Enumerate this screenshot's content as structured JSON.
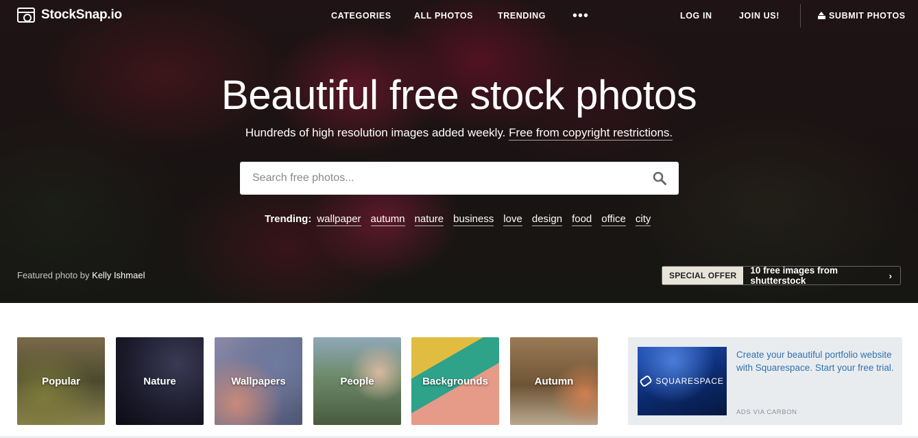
{
  "nav": {
    "brand": "StockSnap.io",
    "categories": "CATEGORIES",
    "all_photos": "ALL PHOTOS",
    "trending": "TRENDING",
    "more": "•••",
    "log_in": "LOG IN",
    "join": "JOIN US!",
    "submit": "SUBMIT PHOTOS"
  },
  "hero": {
    "headline": "Beautiful free stock photos",
    "subline": "Hundreds of high resolution images added weekly.",
    "subline_link": "Free from copyright restrictions.",
    "search_placeholder": "Search free photos...",
    "trending_label": "Trending:",
    "trending_tags": [
      "wallpaper",
      "autumn",
      "nature",
      "business",
      "love",
      "design",
      "food",
      "office",
      "city"
    ],
    "featured_prefix": "Featured photo by",
    "featured_author": "Kelly Ishmael",
    "offer_badge": "SPECIAL OFFER",
    "offer_text": "10 free images from shutterstock",
    "offer_arrow": "›"
  },
  "categories": [
    "Popular",
    "Nature",
    "Wallpapers",
    "People",
    "Backgrounds",
    "Autumn"
  ],
  "ad": {
    "brand": "SQUARESPACE",
    "text": "Create your beautiful portfolio website with Squarespace. Start your free trial.",
    "via": "ADS VIA CARBON"
  },
  "colors": {
    "ad_link": "#2f72b0",
    "ad_bg": "#e9ecef",
    "offer_badge_bg": "#e8e4da"
  }
}
